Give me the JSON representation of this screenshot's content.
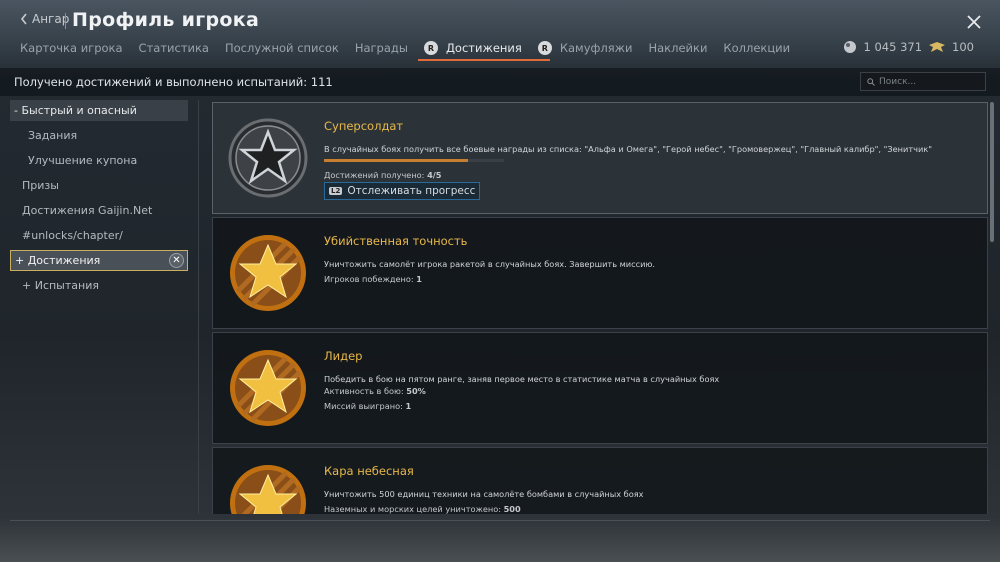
{
  "header": {
    "back_label": "Ангар",
    "title": "Профиль игрока"
  },
  "tabs": [
    "Карточка игрока",
    "Статистика",
    "Послужной список",
    "Награды",
    "Достижения",
    "Камуфляжи",
    "Наклейки",
    "Коллекции"
  ],
  "currency": {
    "silver": "1 045 371",
    "gold": "100"
  },
  "summary": "Получено достижений и выполнено испытаний: 111",
  "search_placeholder": "Поиск...",
  "sidebar": [
    "- Быстрый и опасный",
    "Задания",
    "Улучшение купона",
    "Призы",
    "Достижения Gaijin.Net",
    "#unlocks/chapter/",
    "+ Достижения",
    "+ Испытания"
  ],
  "achievements": [
    {
      "title": "Суперсолдат",
      "description": "В случайных боях получить все боевые награды из списка: \"Альфа и Омега\", \"Герой небес\", \"Громовержец\", \"Главный калибр\", \"Зенитчик\"",
      "progress": 0.8,
      "stat_label": "Достижений получено: ",
      "stat_value": "4/5",
      "track_label": "Отслеживать прогресс"
    },
    {
      "title": "Убийственная точность",
      "description": "Уничтожить самолёт игрока ракетой в случайных боях. Завершить миссию.",
      "stat_label": "Игроков побеждено: ",
      "stat_value": "1"
    },
    {
      "title": "Лидер",
      "description": "Победить в бою на пятом ранге, заняв первое место в статистике матча в случайных боях",
      "stat_label": "Активность в бою: ",
      "stat_value": "50%",
      "stat2_label": "Миссий выиграно: ",
      "stat2_value": "1"
    },
    {
      "title": "Кара небесная",
      "description": "Уничтожить 500 единиц техники на самолёте бомбами в случайных боях",
      "stat_label": "Наземных и морских целей уничтожено: ",
      "stat_value": "500"
    }
  ]
}
